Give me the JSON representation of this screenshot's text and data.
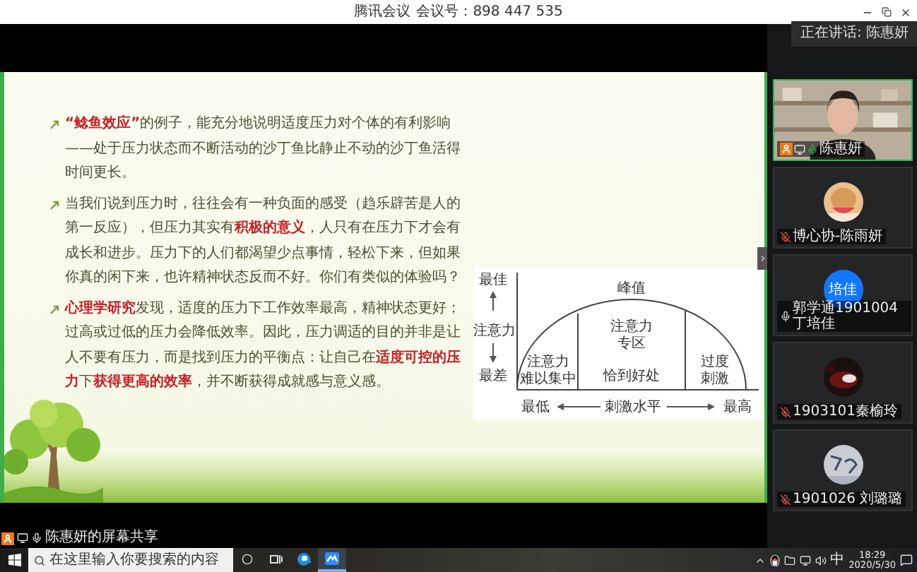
{
  "window": {
    "app": "腾讯会议",
    "meeting_id": "会议号：898 447 535"
  },
  "speaking_notice": "正在讲话: 陈惠妍",
  "slide": {
    "paragraphs": [
      "**“鲶鱼效应”**的例子，能充分地说明适度压力对个体的有利影响——处于压力状态而不断活动的沙丁鱼比静止不动的沙丁鱼活得时间更长。",
      "当我们说到压力时，往往会有一种负面的感受（趋乐辟苦是人的第一反应），但压力其实有**积极的意义**，人只有在压力下才会有成长和进步。压力下的人们都渴望少点事情，轻松下来，但如果你真的闲下来，也许精神状态反而不好。你们有类似的体验吗？",
      "**心理学研究**发现，适度的压力下工作效率最高，精神状态更好；过高或过低的压力会降低效率。因此，压力调适的目的并非是让人不要有压力，而是找到压力的平衡点：让自己在**适度可控的压力**下**获得更高的效率**，并不断获得成就感与意义感。"
    ],
    "diagram": {
      "y_axis": {
        "top": "最佳",
        "label": "注意力",
        "bottom": "最差"
      },
      "x_axis": {
        "left": "最低",
        "label": "刺激水平",
        "right": "最高"
      },
      "peak": "峰值",
      "zones": [
        {
          "lines": [
            "注意力",
            "难以集中"
          ]
        },
        {
          "lines": [
            "注意力",
            "专区"
          ],
          "note": "恰到好处"
        },
        {
          "lines": [
            "过度",
            "刺激"
          ]
        }
      ]
    }
  },
  "screen_share": {
    "label": "陈惠妍的屏幕共享"
  },
  "participants": [
    {
      "name": "陈惠妍",
      "kind": "video",
      "host": true,
      "speaking": true,
      "muted": false
    },
    {
      "name": "博心协-陈雨妍",
      "kind": "picture",
      "host": false,
      "speaking": false,
      "muted": true
    },
    {
      "name": "郭学通1901004丁培佳",
      "kind": "initials",
      "initials": "培佳",
      "host": false,
      "speaking": false,
      "muted": false
    },
    {
      "name": "1903101秦榆玲",
      "kind": "picture",
      "host": false,
      "speaking": false,
      "muted": true
    },
    {
      "name": "1901026 刘璐璐",
      "kind": "picture",
      "host": false,
      "speaking": false,
      "muted": true
    }
  ],
  "taskbar": {
    "search_placeholder": "在这里输入你要搜索的内容",
    "apps": [
      {
        "kind": "browser",
        "selected": false
      },
      {
        "kind": "meeting",
        "selected": true
      }
    ],
    "ime": "中",
    "time": "18:29",
    "date": "2020/5/30"
  }
}
